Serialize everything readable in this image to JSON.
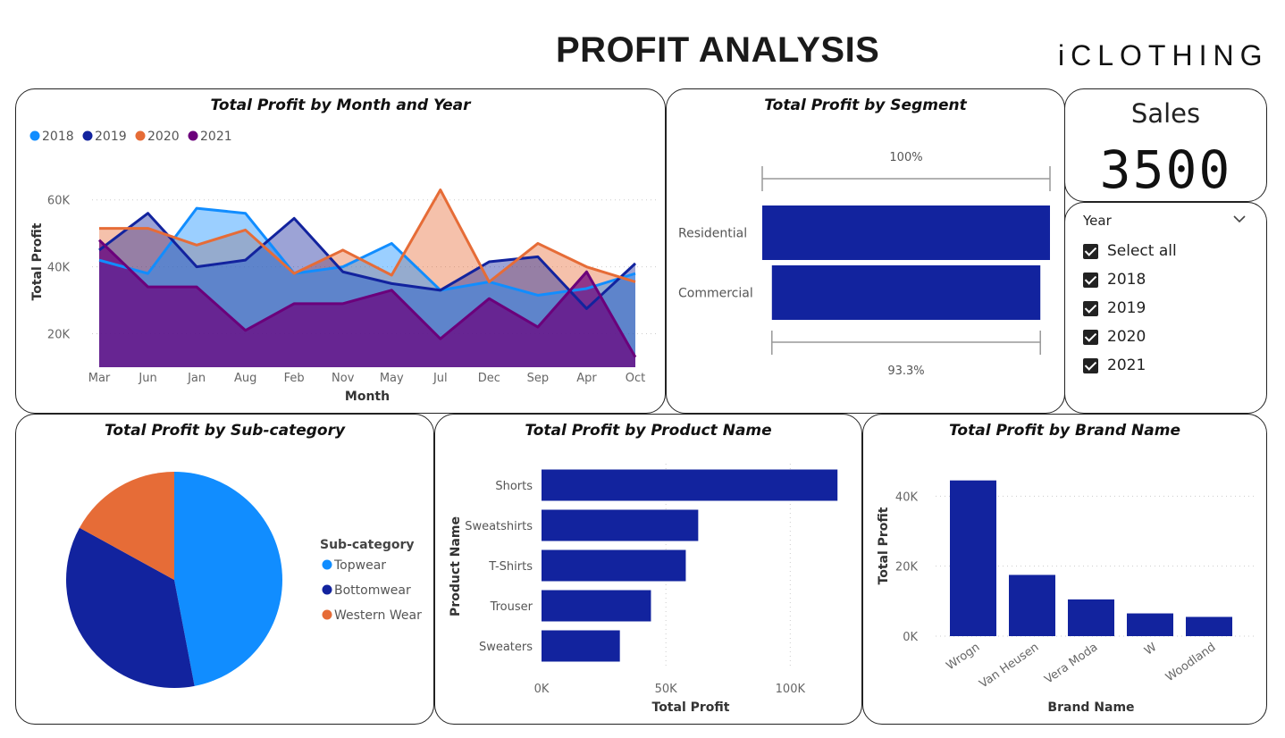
{
  "header": {
    "title": "PROFIT ANALYSIS",
    "logo_text": "iCLOTHING"
  },
  "cards": {
    "month_year": "Total Profit by Month and Year",
    "segment": "Total Profit by Segment",
    "subcategory": "Total Profit by Sub-category",
    "product": "Total Profit by Product Name",
    "brand": "Total Profit by Brand Name"
  },
  "sales_card": {
    "label": "Sales",
    "value": "3500"
  },
  "slicer": {
    "title": "Year",
    "items": [
      {
        "label": "Select all",
        "checked": true
      },
      {
        "label": "2018",
        "checked": true
      },
      {
        "label": "2019",
        "checked": true
      },
      {
        "label": "2020",
        "checked": true
      },
      {
        "label": "2021",
        "checked": true
      }
    ]
  },
  "chart_data": [
    {
      "id": "month_year",
      "type": "area",
      "title": "Total Profit by Month and Year",
      "xlabel": "Month",
      "ylabel": "Total Profit",
      "categories": [
        "Mar",
        "Jun",
        "Jan",
        "Aug",
        "Feb",
        "Nov",
        "May",
        "Jul",
        "Dec",
        "Sep",
        "Apr",
        "Oct"
      ],
      "ylim": [
        10000,
        65000
      ],
      "yticks": [
        20000,
        40000,
        60000
      ],
      "ytick_labels": [
        "20K",
        "40K",
        "60K"
      ],
      "legend_position": "top-left",
      "grid": true,
      "series": [
        {
          "name": "2018",
          "color": "#118dff",
          "values": [
            42000,
            38000,
            57500,
            56000,
            38000,
            40000,
            47000,
            33000,
            35500,
            31500,
            33500,
            38000
          ]
        },
        {
          "name": "2019",
          "color": "#12239e",
          "values": [
            45000,
            56000,
            40000,
            42000,
            54500,
            38500,
            35000,
            33000,
            41500,
            43000,
            27500,
            41000
          ]
        },
        {
          "name": "2020",
          "color": "#e66c37",
          "values": [
            51500,
            51500,
            46500,
            51000,
            38000,
            45000,
            37500,
            63000,
            35500,
            47000,
            40000,
            35500
          ]
        },
        {
          "name": "2021",
          "color": "#6b007b",
          "values": [
            48000,
            34000,
            34000,
            21000,
            29000,
            29000,
            33000,
            18500,
            30500,
            22000,
            38500,
            13000
          ]
        }
      ]
    },
    {
      "id": "segment",
      "type": "bar",
      "title": "Total Profit by Segment",
      "categories": [
        "Residential",
        "Commercial"
      ],
      "values": [
        100,
        93.3
      ],
      "value_unit": "percent of top",
      "annotations": [
        "100%",
        "93.3%"
      ],
      "color": "#12239e"
    },
    {
      "id": "subcategory",
      "type": "pie",
      "title": "Total Profit by Sub-category",
      "legend_title": "Sub-category",
      "legend_position": "right",
      "labels": [
        "Topwear",
        "Bottomwear",
        "Western Wear"
      ],
      "values": [
        47,
        36,
        17
      ],
      "colors": [
        "#118dff",
        "#12239e",
        "#e66c37"
      ]
    },
    {
      "id": "product",
      "type": "bar",
      "orientation": "horizontal",
      "title": "Total Profit by Product Name",
      "xlabel": "Total Profit",
      "ylabel": "Product Name",
      "categories": [
        "Shorts",
        "Sweatshirts",
        "T-Shirts",
        "Trouser",
        "Sweaters"
      ],
      "values": [
        119000,
        63000,
        58000,
        44000,
        31500
      ],
      "xlim": [
        0,
        120000
      ],
      "xticks": [
        0,
        50000,
        100000
      ],
      "xtick_labels": [
        "0K",
        "50K",
        "100K"
      ],
      "grid": true,
      "color": "#12239e"
    },
    {
      "id": "brand",
      "type": "bar",
      "title": "Total Profit by Brand Name",
      "xlabel": "Brand Name",
      "ylabel": "Total Profit",
      "categories": [
        "Wrogn",
        "Van Heusen",
        "Vera Moda",
        "W",
        "Woodland"
      ],
      "values": [
        44500,
        17500,
        10500,
        6500,
        5500
      ],
      "ylim": [
        0,
        48000
      ],
      "yticks": [
        0,
        20000,
        40000
      ],
      "ytick_labels": [
        "0K",
        "20K",
        "40K"
      ],
      "grid": true,
      "color": "#12239e"
    }
  ]
}
